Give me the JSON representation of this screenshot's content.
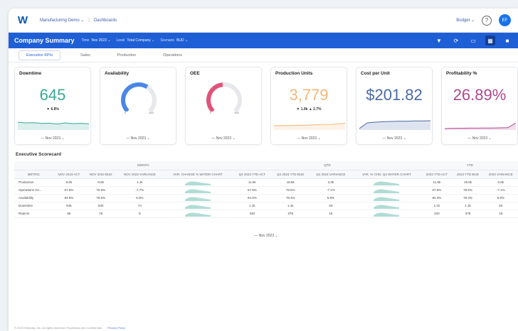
{
  "topbar": {
    "logo": "W",
    "breadcrumb": [
      "Manufacturing Demo ⌄",
      "Dashboards"
    ],
    "budget": "Budget ⌄",
    "help": "?",
    "avatar": "EF"
  },
  "header": {
    "title": "Company Summary",
    "filters": [
      {
        "label": "Time",
        "value": "Nov 2023 ⌄"
      },
      {
        "label": "Level",
        "value": "Total Company ⌄"
      },
      {
        "label": "Scenario",
        "value": "BUD ⌄"
      }
    ]
  },
  "tabs": [
    "Executive KPIs",
    "Sales",
    "Production",
    "Operations"
  ],
  "kpis": [
    {
      "title": "Downtime",
      "value": "645",
      "delta": "▼ 6.8%",
      "color": "#3aa895",
      "foot": "— Nov 2023 ⌄",
      "type": "number",
      "trend": [
        0.55,
        0.5,
        0.52,
        0.46,
        0.48,
        0.42,
        0.5,
        0.45,
        0.47,
        0.44
      ]
    },
    {
      "title": "Availability",
      "value": "",
      "gauge_fill": 0.62,
      "gauge_color": "#4a86e8",
      "gauge_min": "0",
      "gauge_max": "100",
      "foot": "— Nov 2023 ⌄",
      "type": "gauge"
    },
    {
      "title": "OEE",
      "value": "",
      "gauge_fill": 0.48,
      "gauge_color": "#e0537a",
      "gauge_min": "0",
      "gauge_max": "100",
      "foot": "— Nov 2023 ⌄",
      "type": "gauge"
    },
    {
      "title": "Production Units",
      "value": "3,779",
      "delta": "▼ 1.9k ▲ 2.7%",
      "color": "#f5b77a",
      "foot": "— Nov 2023 ⌄",
      "type": "number",
      "trend": [
        0.3,
        0.32,
        0.31,
        0.34,
        0.33,
        0.36,
        0.38,
        0.39,
        0.42,
        0.48
      ]
    },
    {
      "title": "Cost per Unit",
      "value": "$201.82",
      "color": "#4a6aa5",
      "foot": "— Nov 2023 ⌄",
      "type": "number",
      "trend": [
        0.1,
        0.5,
        0.55,
        0.58,
        0.6,
        0.62,
        0.62,
        0.64,
        0.64,
        0.65
      ]
    },
    {
      "title": "Profitability %",
      "value": "26.89%",
      "color": "#b0478e",
      "foot": "— Nov 2023 ⌄",
      "type": "number",
      "trend": [
        0.1,
        0.12,
        0.12,
        0.13,
        0.13,
        0.14,
        0.14,
        0.15,
        0.16,
        0.5
      ]
    }
  ],
  "scorecard": {
    "title": "Executive Scorecard",
    "groups": [
      "MONTH",
      "QTD",
      "YTD"
    ],
    "columns": [
      "METRIC",
      "NOV 2023 ACT",
      "NOV 2023 BUD",
      "NOV 2023 VARIANCE",
      "VAR. CHANGE % WATER CHART",
      "Q4 2023 YTD ACT",
      "Q4 2023 YTD BUD",
      "Q4 2023 VARIANCE",
      "VAR. % CHG. Q4 WATER CHART",
      "2023 YTD ACT",
      "2023 YTD BUD",
      "2023 VARIANCE"
    ],
    "rows": [
      {
        "metric": "Production",
        "values": [
          "8.6k",
          "8.5k",
          "1.1k",
          "",
          "11.6k",
          "18.5k",
          "3.3k",
          "",
          "11.6k",
          "19.5k",
          "0.6k"
        ]
      },
      {
        "metric": "Operations Ov...",
        "values": [
          "67.8%",
          "70.9%",
          "-7.7%",
          "",
          "67.8%",
          "78.5%",
          "-7.1%",
          "",
          "67.8%",
          "78.5%",
          "-7.1%"
        ]
      },
      {
        "metric": "Availability",
        "values": [
          "84.5%",
          "78.5%",
          "6.0%",
          "",
          "84.3%",
          "78.4%",
          "5.9%",
          "",
          "84.3%",
          "78.4%",
          "5.9%"
        ]
      },
      {
        "metric": "Downtime",
        "values": [
          "645",
          "530",
          "74",
          "",
          "1.1k",
          "1.1k",
          "53",
          "",
          "1.1k",
          "1.1k",
          "53"
        ]
      },
      {
        "metric": "Rejects",
        "values": [
          "86",
          "78",
          "8",
          "",
          "340",
          "378",
          "18",
          "",
          "340",
          "378",
          "18"
        ]
      }
    ],
    "footer": "— Nov 2023 ⌄"
  },
  "legal": {
    "text": "© 2023 Workday, Inc. All rights reserved. Proprietary and Confidential.",
    "link": "Privacy Policy"
  }
}
